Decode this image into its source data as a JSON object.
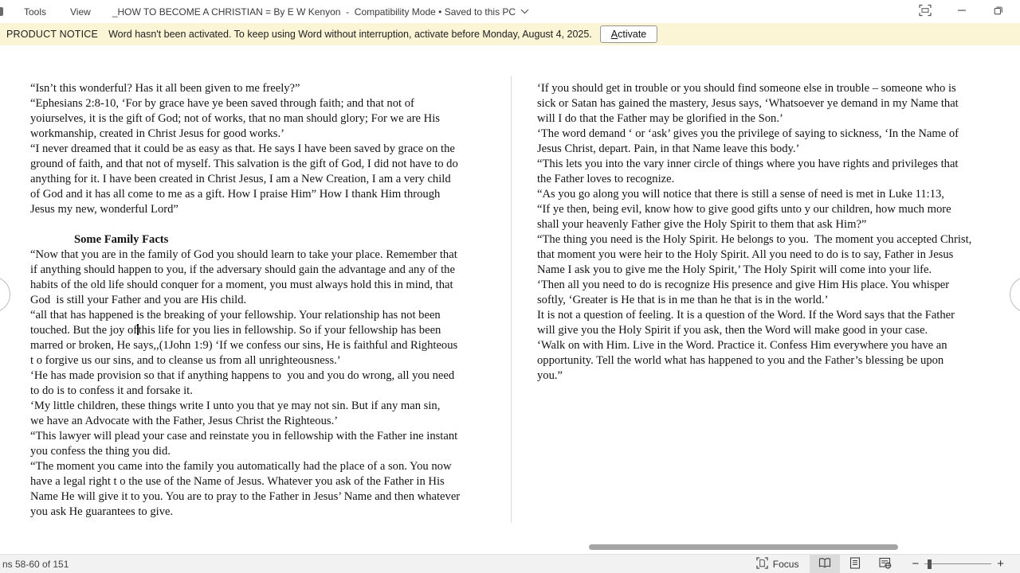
{
  "titlebar": {
    "menus": [
      "Tools",
      "View"
    ],
    "title": "_HOW TO BECOME A CHRISTIAN = By E W Kenyon  -  Compatibility Mode • Saved to this PC"
  },
  "notice": {
    "label": "PRODUCT NOTICE",
    "message": "Word hasn't been activated. To keep using Word without interruption, activate before Monday, August 4, 2025.",
    "activate_label": "Activate"
  },
  "document": {
    "left_page": {
      "lines": [
        "“Isn’t this wonderful? Has it all been given to me freely?”",
        "“Ephesians 2:8-10, ‘For by grace have ye been saved through faith; and that not of",
        "yoiurselves, it is the gift of God; not of works, that no man should glory; For we are His",
        "workmanship, created in Christ Jesus for good works.’",
        "“I never dreamed that it could be as easy as that. He says I have been saved by grace on the",
        "ground of faith, and that not of myself. This salvation is the gift of God, I did not have to do",
        "anything for it. I have been created in Christ Jesus, I am a New Creation, I am a very child",
        "of God and it has all come to me as a gift. How I praise Him” How I thank Him through",
        "Jesus my new, wonderful Lord”",
        "",
        {
          "heading": true,
          "text": "Some Family Facts"
        },
        "“Now that you are in the family of God you should learn to take your place. Remember that",
        "if anything should happen to you, if the adversary should gain the advantage and any of the",
        "habits of the old life should conquer for a moment, you must always hold this in mind, that",
        "God  is still your Father and you are His child.",
        "“all that has happened is the breaking of your fellowship. Your relationship has not been",
        {
          "caret": true,
          "before": "touched. But the joy of",
          "after": "this life for you lies in fellowship. So if your fellowship has been"
        },
        "marred or broken, He says,,(1John 1:9) ‘If we confess our sins, He is faithful and Righteous",
        "t o forgive us our sins, and to cleanse us from all unrighteousness.’",
        "‘He has made provision so that if anything happens to  you and you do wrong, all you need",
        "to do is to confess it and forsake it.",
        "‘My little children, these things write I unto you that ye may not sin. But if any man sin,",
        "we have an Advocate with the Father, Jesus Christ the Righteous.’",
        "“This lawyer will plead your case and reinstate you in fellowship with the Father ine instant",
        "you confess the thing you did.",
        "“The moment you came into the family you automatically had the place of a son. You now",
        "have a legal right t o the use of the Name of Jesus. Whatever you ask of the Father in His",
        "Name He will give it to you. You are to pray to the Father in Jesus’ Name and then whatever",
        "you ask He guarantees to give."
      ]
    },
    "right_page": {
      "lines": [
        "‘If you should get in trouble or you should find someone else in trouble – someone who is",
        "sick or Satan has gained the mastery, Jesus says, ‘Whatsoever ye demand in my Name that",
        "will I do that the Father may be glorified in the Son.’",
        "‘The word demand ‘ or ‘ask’ gives you the privilege of saying to sickness, ‘In the Name of",
        "Jesus Christ, depart. Pain, in that Name leave this body.’",
        "“This lets you into the vary inner circle of things where you have rights and privileges that",
        "the Father loves to recognize.",
        "“As you go along you will notice that there is still a sense of need is met in Luke 11:13,",
        "“If ye then, being evil, know how to give good gifts unto y our children, how much more",
        "shall your heavenly Father give the Holy Spirit to them that ask Him?”",
        "“The thing you need is the Holy Spirit. He belongs to you.  The moment you accepted Christ,",
        "that moment you were heir to the Holy Spirit. All you need to do is to say, Father in Jesus",
        "Name I ask you to give me the Holy Spirit,’ The Holy Spirit will come into your life.",
        "‘Then all you need to do is recognize His presence and give Him His place. You whisper",
        "softly, ‘Greater is He that is in me than he that is in the world.’",
        "It is not a question of feeling. It is a question of the Word. If the Word says that the Father",
        "will give you the Holy Spirit if you ask, then the Word will make good in your case.",
        "‘Walk on with Him. Live in the Word. Practice it. Confess Him everywhere you have an",
        "opportunity. Tell the world what has happened to you and the Father’s blessing be upon",
        "you.”"
      ]
    }
  },
  "statusbar": {
    "screens_label": "ns 58-60 of 151",
    "focus_label": "Focus",
    "zoom_out_glyph": "−",
    "zoom_in_glyph": "+"
  },
  "colors": {
    "notice_background": "#fbf4d5",
    "scrollbar_thumb": "#a5a5a5",
    "selected_view_button": "#dbdbdb"
  }
}
